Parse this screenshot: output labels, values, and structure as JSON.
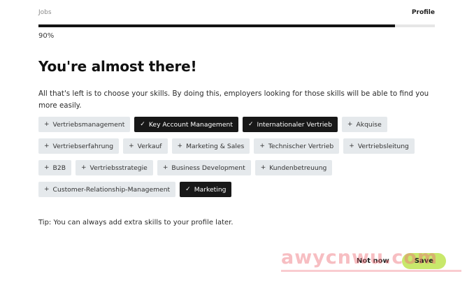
{
  "steps": {
    "left": "Jobs",
    "right": "Profile"
  },
  "progress": {
    "fraction": 0.9,
    "label": "90%"
  },
  "title": "You're almost there!",
  "intro": "All that's left is to choose your skills. By doing this, employers looking for those skills will be able to find you more easily.",
  "marks": {
    "add": "+",
    "selected": "✓"
  },
  "skills": [
    [
      {
        "label": "Vertriebsmanagement",
        "selected": false
      },
      {
        "label": "Key Account Management",
        "selected": true
      },
      {
        "label": "Internationaler Vertrieb",
        "selected": true
      },
      {
        "label": "Akquise",
        "selected": false
      }
    ],
    [
      {
        "label": "Vertriebserfahrung",
        "selected": false
      },
      {
        "label": "Verkauf",
        "selected": false
      },
      {
        "label": "Marketing & Sales",
        "selected": false
      },
      {
        "label": "Technischer Vertrieb",
        "selected": false
      },
      {
        "label": "Vertriebsleitung",
        "selected": false
      }
    ],
    [
      {
        "label": "B2B",
        "selected": false
      },
      {
        "label": "Vertriebsstrategie",
        "selected": false
      },
      {
        "label": "Business Development",
        "selected": false
      },
      {
        "label": "Kundenbetreuung",
        "selected": false
      }
    ],
    [
      {
        "label": "Customer-Relationship-Management",
        "selected": false
      },
      {
        "label": "Marketing",
        "selected": true
      }
    ]
  ],
  "tip": "Tip: You can always add extra skills to your profile later.",
  "buttons": {
    "not_now": "Not now",
    "save": "Save"
  },
  "watermark": "awycnwu.com",
  "colors": {
    "selected_chip": "#181818",
    "chip": "#e5e9ec",
    "save_button": "#c8e86b",
    "progress": "#141414"
  }
}
